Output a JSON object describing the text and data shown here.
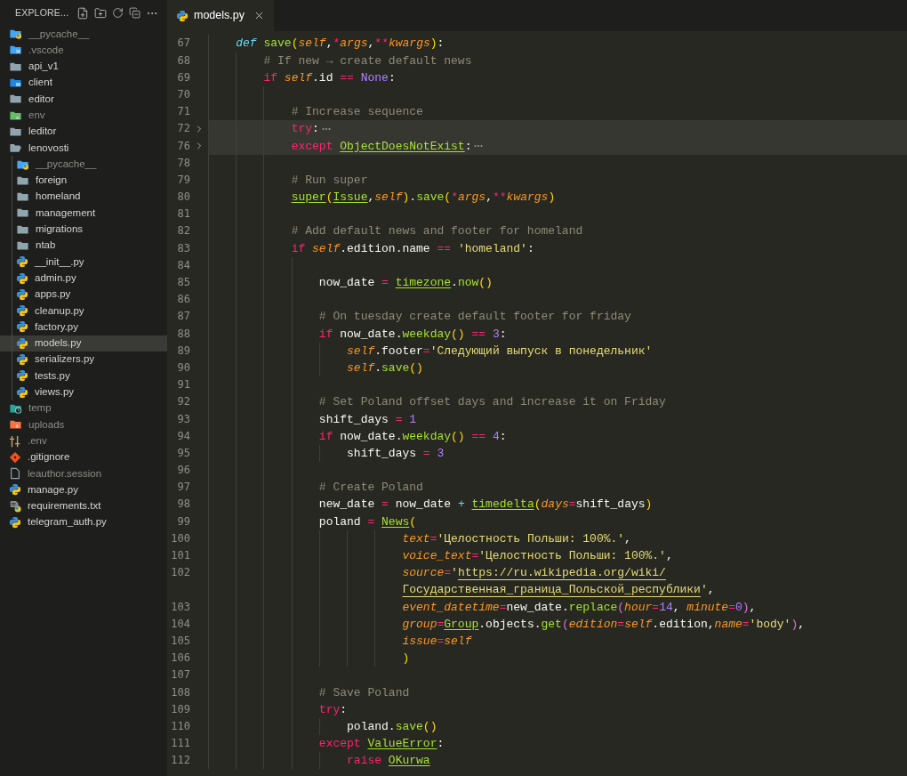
{
  "explorer": {
    "title": "EXPLORE...",
    "tree": [
      {
        "name": "__pycache__",
        "kind": "folder-python",
        "dimmed": true,
        "selected": false,
        "expanded": false
      },
      {
        "name": ".vscode",
        "kind": "folder-vscode",
        "dimmed": true,
        "selected": false,
        "expanded": false
      },
      {
        "name": "api_v1",
        "kind": "folder",
        "dimmed": false,
        "selected": false,
        "expanded": false
      },
      {
        "name": "client",
        "kind": "folder-client",
        "dimmed": false,
        "selected": false,
        "expanded": false
      },
      {
        "name": "editor",
        "kind": "folder",
        "dimmed": false,
        "selected": false,
        "expanded": false
      },
      {
        "name": "env",
        "kind": "folder-env",
        "dimmed": true,
        "selected": false,
        "expanded": false
      },
      {
        "name": "leditor",
        "kind": "folder",
        "dimmed": false,
        "selected": false,
        "expanded": false
      },
      {
        "name": "lenovosti",
        "kind": "folder",
        "dimmed": false,
        "selected": false,
        "expanded": true,
        "children": [
          {
            "name": "__pycache__",
            "kind": "folder-python",
            "dimmed": true,
            "selected": false,
            "expanded": false
          },
          {
            "name": "foreign",
            "kind": "folder",
            "dimmed": false,
            "selected": false,
            "expanded": false
          },
          {
            "name": "homeland",
            "kind": "folder",
            "dimmed": false,
            "selected": false,
            "expanded": false
          },
          {
            "name": "management",
            "kind": "folder",
            "dimmed": false,
            "selected": false,
            "expanded": false
          },
          {
            "name": "migrations",
            "kind": "folder",
            "dimmed": false,
            "selected": false,
            "expanded": false
          },
          {
            "name": "ntab",
            "kind": "folder",
            "dimmed": false,
            "selected": false,
            "expanded": false
          },
          {
            "name": "__init__.py",
            "kind": "python",
            "dimmed": false,
            "selected": false
          },
          {
            "name": "admin.py",
            "kind": "python",
            "dimmed": false,
            "selected": false
          },
          {
            "name": "apps.py",
            "kind": "python",
            "dimmed": false,
            "selected": false
          },
          {
            "name": "cleanup.py",
            "kind": "python",
            "dimmed": false,
            "selected": false
          },
          {
            "name": "factory.py",
            "kind": "python",
            "dimmed": false,
            "selected": false
          },
          {
            "name": "models.py",
            "kind": "python",
            "dimmed": false,
            "selected": true
          },
          {
            "name": "serializers.py",
            "kind": "python",
            "dimmed": false,
            "selected": false
          },
          {
            "name": "tests.py",
            "kind": "python",
            "dimmed": false,
            "selected": false
          },
          {
            "name": "views.py",
            "kind": "python",
            "dimmed": false,
            "selected": false
          }
        ]
      },
      {
        "name": "temp",
        "kind": "folder-temp",
        "dimmed": true,
        "selected": false,
        "expanded": false
      },
      {
        "name": "uploads",
        "kind": "folder-uploads",
        "dimmed": true,
        "selected": false,
        "expanded": false
      },
      {
        "name": ".env",
        "kind": "settings",
        "dimmed": true,
        "selected": false
      },
      {
        "name": ".gitignore",
        "kind": "git",
        "dimmed": false,
        "selected": false
      },
      {
        "name": "leauthor.session",
        "kind": "file",
        "dimmed": true,
        "selected": false
      },
      {
        "name": "manage.py",
        "kind": "python",
        "dimmed": false,
        "selected": false
      },
      {
        "name": "requirements.txt",
        "kind": "text-python",
        "dimmed": false,
        "selected": false
      },
      {
        "name": "telegram_auth.py",
        "kind": "python",
        "dimmed": false,
        "selected": false
      }
    ]
  },
  "tabs": [
    {
      "label": "models.py",
      "selected": true
    }
  ],
  "editor": {
    "lines": [
      {
        "number": "67",
        "folded": false,
        "tokens": [
          {
            "kind": "storage",
            "text": "    def "
          },
          {
            "kind": "function",
            "text": "save"
          },
          {
            "kind": "bracket",
            "text": "("
          },
          {
            "kind": "self",
            "text": "self"
          },
          {
            "kind": "plain",
            "text": ","
          },
          {
            "kind": "operator",
            "text": "*"
          },
          {
            "kind": "param",
            "text": "args"
          },
          {
            "kind": "plain",
            "text": ","
          },
          {
            "kind": "operator",
            "text": "**"
          },
          {
            "kind": "param",
            "text": "kwargs"
          },
          {
            "kind": "bracket",
            "text": ")"
          },
          {
            "kind": "plain",
            "text": ":"
          }
        ]
      },
      {
        "number": "68",
        "folded": false,
        "tokens": [
          {
            "kind": "comment",
            "text": "        # If new → create default news"
          }
        ]
      },
      {
        "number": "69",
        "folded": false,
        "tokens": [
          {
            "kind": "keyword",
            "text": "        if "
          },
          {
            "kind": "self",
            "text": "self"
          },
          {
            "kind": "plain",
            "text": ".id "
          },
          {
            "kind": "operator",
            "text": "== "
          },
          {
            "kind": "number",
            "text": "None"
          },
          {
            "kind": "plain",
            "text": ":"
          }
        ]
      },
      {
        "number": "70",
        "folded": false
      },
      {
        "number": "71",
        "folded": false,
        "tokens": [
          {
            "kind": "comment",
            "text": "            # Increase sequence"
          }
        ]
      },
      {
        "number": "72",
        "folded": true,
        "tokens": [
          {
            "kind": "keyword",
            "text": "            try"
          },
          {
            "kind": "plain",
            "text": ":"
          }
        ]
      },
      {
        "number": "76",
        "folded": true,
        "tokens": [
          {
            "kind": "keyword",
            "text": "            except "
          },
          {
            "kind": "class",
            "text": "ObjectDoesNotExist"
          },
          {
            "kind": "plain",
            "text": ":"
          }
        ]
      },
      {
        "number": "78",
        "folded": false
      },
      {
        "number": "79",
        "folded": false,
        "tokens": [
          {
            "kind": "comment",
            "text": "            # Run super"
          }
        ]
      },
      {
        "number": "80",
        "folded": false,
        "tokens": [
          {
            "kind": "class",
            "text": "            super"
          },
          {
            "kind": "bracket",
            "text": "("
          },
          {
            "kind": "class",
            "text": "Issue"
          },
          {
            "kind": "plain",
            "text": ","
          },
          {
            "kind": "self",
            "text": "self"
          },
          {
            "kind": "bracket",
            "text": ")"
          },
          {
            "kind": "plain",
            "text": "."
          },
          {
            "kind": "function",
            "text": "save"
          },
          {
            "kind": "bracket",
            "text": "("
          },
          {
            "kind": "operator",
            "text": "*"
          },
          {
            "kind": "param",
            "text": "args"
          },
          {
            "kind": "plain",
            "text": ","
          },
          {
            "kind": "operator",
            "text": "**"
          },
          {
            "kind": "param",
            "text": "kwargs"
          },
          {
            "kind": "bracket",
            "text": ")"
          }
        ]
      },
      {
        "number": "81",
        "folded": false
      },
      {
        "number": "82",
        "folded": false,
        "tokens": [
          {
            "kind": "comment",
            "text": "            # Add default news and footer for homeland"
          }
        ]
      },
      {
        "number": "83",
        "folded": false,
        "tokens": [
          {
            "kind": "keyword",
            "text": "            if "
          },
          {
            "kind": "self",
            "text": "self"
          },
          {
            "kind": "plain",
            "text": ".edition.name "
          },
          {
            "kind": "operator",
            "text": "== "
          },
          {
            "kind": "string",
            "text": "'homeland'"
          },
          {
            "kind": "plain",
            "text": ":"
          }
        ]
      },
      {
        "number": "84",
        "folded": false
      },
      {
        "number": "85",
        "folded": false,
        "tokens": [
          {
            "kind": "plain",
            "text": "                now_date "
          },
          {
            "kind": "operator",
            "text": "= "
          },
          {
            "kind": "class",
            "text": "timezone"
          },
          {
            "kind": "plain",
            "text": "."
          },
          {
            "kind": "function",
            "text": "now"
          },
          {
            "kind": "bracket",
            "text": "()"
          }
        ]
      },
      {
        "number": "86",
        "folded": false
      },
      {
        "number": "87",
        "folded": false,
        "tokens": [
          {
            "kind": "comment",
            "text": "                # On tuesday create default footer for friday"
          }
        ]
      },
      {
        "number": "88",
        "folded": false,
        "tokens": [
          {
            "kind": "keyword",
            "text": "                if "
          },
          {
            "kind": "plain",
            "text": "now_date."
          },
          {
            "kind": "function",
            "text": "weekday"
          },
          {
            "kind": "bracket",
            "text": "()"
          },
          {
            "kind": "operator",
            "text": " == "
          },
          {
            "kind": "number",
            "text": "3"
          },
          {
            "kind": "plain",
            "text": ":"
          }
        ]
      },
      {
        "number": "89",
        "folded": false,
        "tokens": [
          {
            "kind": "self",
            "text": "                    self"
          },
          {
            "kind": "plain",
            "text": ".footer"
          },
          {
            "kind": "operator",
            "text": "="
          },
          {
            "kind": "string",
            "text": "'Следующий выпуск в понедельник'"
          }
        ]
      },
      {
        "number": "90",
        "folded": false,
        "tokens": [
          {
            "kind": "self",
            "text": "                    self"
          },
          {
            "kind": "plain",
            "text": "."
          },
          {
            "kind": "function",
            "text": "save"
          },
          {
            "kind": "bracket",
            "text": "()"
          }
        ]
      },
      {
        "number": "91",
        "folded": false
      },
      {
        "number": "92",
        "folded": false,
        "tokens": [
          {
            "kind": "comment",
            "text": "                # Set Poland offset days and increase it on Friday"
          }
        ]
      },
      {
        "number": "93",
        "folded": false,
        "tokens": [
          {
            "kind": "plain",
            "text": "                shift_days "
          },
          {
            "kind": "operator",
            "text": "= "
          },
          {
            "kind": "number",
            "text": "1"
          }
        ]
      },
      {
        "number": "94",
        "folded": false,
        "tokens": [
          {
            "kind": "keyword",
            "text": "                if "
          },
          {
            "kind": "plain",
            "text": "now_date."
          },
          {
            "kind": "function",
            "text": "weekday"
          },
          {
            "kind": "bracket",
            "text": "()"
          },
          {
            "kind": "operator",
            "text": " == "
          },
          {
            "kind": "number",
            "text": "4"
          },
          {
            "kind": "plain",
            "text": ":"
          }
        ]
      },
      {
        "number": "95",
        "folded": false,
        "tokens": [
          {
            "kind": "plain",
            "text": "                    shift_days "
          },
          {
            "kind": "operator",
            "text": "= "
          },
          {
            "kind": "number",
            "text": "3"
          }
        ]
      },
      {
        "number": "96",
        "folded": false
      },
      {
        "number": "97",
        "folded": false,
        "tokens": [
          {
            "kind": "comment",
            "text": "                # Create Poland"
          }
        ]
      },
      {
        "number": "98",
        "folded": false,
        "tokens": [
          {
            "kind": "plain",
            "text": "                new_date "
          },
          {
            "kind": "operator",
            "text": "="
          },
          {
            "kind": "plain",
            "text": " now_date "
          },
          {
            "kind": "arith",
            "text": "+ "
          },
          {
            "kind": "class",
            "text": "timedelta"
          },
          {
            "kind": "bracket",
            "text": "("
          },
          {
            "kind": "param",
            "text": "days"
          },
          {
            "kind": "operator",
            "text": "="
          },
          {
            "kind": "plain",
            "text": "shift_days"
          },
          {
            "kind": "bracket",
            "text": ")"
          }
        ]
      },
      {
        "number": "99",
        "folded": false,
        "tokens": [
          {
            "kind": "plain",
            "text": "                poland "
          },
          {
            "kind": "operator",
            "text": "= "
          },
          {
            "kind": "class",
            "text": "News"
          },
          {
            "kind": "bracket",
            "text": "("
          }
        ]
      },
      {
        "number": "100",
        "folded": false,
        "tokens": [
          {
            "kind": "param",
            "text": "                            text"
          },
          {
            "kind": "operator",
            "text": "="
          },
          {
            "kind": "string",
            "text": "'Целостность Польши: 100%.'"
          },
          {
            "kind": "plain",
            "text": ","
          }
        ]
      },
      {
        "number": "101",
        "folded": false,
        "tokens": [
          {
            "kind": "param",
            "text": "                            voice_text"
          },
          {
            "kind": "operator",
            "text": "="
          },
          {
            "kind": "string",
            "text": "'Целостность Польши: 100%.'"
          },
          {
            "kind": "plain",
            "text": ","
          }
        ]
      },
      {
        "number": "102",
        "folded": false,
        "tokens": [
          {
            "kind": "param",
            "text": "                            source"
          },
          {
            "kind": "operator",
            "text": "="
          },
          {
            "kind": "string",
            "text": "'"
          },
          {
            "kind": "link",
            "text": "https://ru.wikipedia.org/wiki/"
          }
        ]
      },
      {
        "folded": false,
        "tokens": [
          {
            "kind": "link",
            "text": "                            Государственная_граница_Польской_республики"
          },
          {
            "kind": "string",
            "text": "'"
          },
          {
            "kind": "plain",
            "text": ","
          }
        ]
      },
      {
        "number": "103",
        "folded": false,
        "tokens": [
          {
            "kind": "param",
            "text": "                            event_datetime"
          },
          {
            "kind": "operator",
            "text": "="
          },
          {
            "kind": "plain",
            "text": "new_date."
          },
          {
            "kind": "function",
            "text": "replace"
          },
          {
            "kind": "bracket2",
            "text": "("
          },
          {
            "kind": "param",
            "text": "hour"
          },
          {
            "kind": "operator",
            "text": "="
          },
          {
            "kind": "number",
            "text": "14"
          },
          {
            "kind": "plain",
            "text": ", "
          },
          {
            "kind": "param",
            "text": "minute"
          },
          {
            "kind": "operator",
            "text": "="
          },
          {
            "kind": "number",
            "text": "0"
          },
          {
            "kind": "bracket2",
            "text": ")"
          },
          {
            "kind": "plain",
            "text": ","
          }
        ]
      },
      {
        "number": "104",
        "folded": false,
        "tokens": [
          {
            "kind": "param",
            "text": "                            group"
          },
          {
            "kind": "operator",
            "text": "="
          },
          {
            "kind": "class",
            "text": "Group"
          },
          {
            "kind": "plain",
            "text": ".objects."
          },
          {
            "kind": "function",
            "text": "get"
          },
          {
            "kind": "bracket2",
            "text": "("
          },
          {
            "kind": "param",
            "text": "edition"
          },
          {
            "kind": "operator",
            "text": "="
          },
          {
            "kind": "self",
            "text": "self"
          },
          {
            "kind": "plain",
            "text": ".edition,"
          },
          {
            "kind": "param",
            "text": "name"
          },
          {
            "kind": "operator",
            "text": "="
          },
          {
            "kind": "string",
            "text": "'body'"
          },
          {
            "kind": "bracket2",
            "text": ")"
          },
          {
            "kind": "plain",
            "text": ","
          }
        ]
      },
      {
        "number": "105",
        "folded": false,
        "tokens": [
          {
            "kind": "param",
            "text": "                            issue"
          },
          {
            "kind": "operator",
            "text": "="
          },
          {
            "kind": "self",
            "text": "self"
          }
        ]
      },
      {
        "number": "106",
        "folded": false,
        "tokens": [
          {
            "kind": "bracket",
            "text": "                            )"
          }
        ]
      },
      {
        "number": "107",
        "folded": false
      },
      {
        "number": "108",
        "folded": false,
        "tokens": [
          {
            "kind": "comment",
            "text": "                # Save Poland"
          }
        ]
      },
      {
        "number": "109",
        "folded": false,
        "tokens": [
          {
            "kind": "keyword",
            "text": "                try"
          },
          {
            "kind": "plain",
            "text": ":"
          }
        ]
      },
      {
        "number": "110",
        "folded": false,
        "tokens": [
          {
            "kind": "plain",
            "text": "                    poland."
          },
          {
            "kind": "function",
            "text": "save"
          },
          {
            "kind": "bracket",
            "text": "()"
          }
        ]
      },
      {
        "number": "111",
        "folded": false,
        "tokens": [
          {
            "kind": "keyword",
            "text": "                except "
          },
          {
            "kind": "class",
            "text": "ValueError"
          },
          {
            "kind": "plain",
            "text": ":"
          }
        ]
      },
      {
        "number": "112",
        "folded": false,
        "tokens": [
          {
            "kind": "keyword",
            "text": "                    raise "
          },
          {
            "kind": "class",
            "text": "OKurwa"
          }
        ]
      }
    ]
  }
}
